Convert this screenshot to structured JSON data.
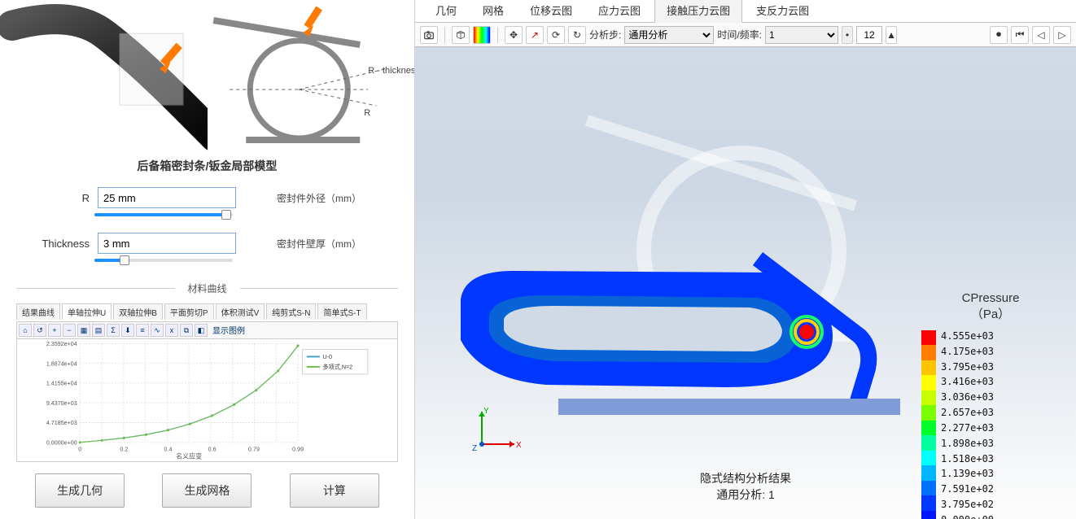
{
  "model_title": "后备箱密封条/钣金局部模型",
  "diagram_labels": {
    "r": "R",
    "thickness": "R - thickness"
  },
  "params": {
    "r": {
      "label": "R",
      "value": "25 mm",
      "desc": "密封件外径（mm）",
      "slider_percent": 95
    },
    "thickness": {
      "label": "Thickness",
      "value": "3 mm",
      "desc": "密封件壁厚（mm）",
      "slider_percent": 22
    }
  },
  "section_material": "材料曲线",
  "mat_tabs": [
    "结果曲线",
    "单轴拉伸U",
    "双轴拉伸B",
    "平面剪切P",
    "体积测试V",
    "纯剪式S-N",
    "简单式S-T"
  ],
  "mat_tab_active": 1,
  "chart_toolbar_legend": "显示图例",
  "chart_legend": {
    "s1": "U-0",
    "s2": "多项式,N=2"
  },
  "chart_xlabel": "名义应变",
  "chart_data": {
    "type": "line",
    "xlabel": "名义应变",
    "ylabel": "",
    "categories": [
      0,
      0.2,
      0.4,
      0.6,
      0.79,
      0.99
    ],
    "y_ticks": [
      "0.0000e+00",
      "4.7185e+03",
      "9.4370e+03",
      "1.4155e+04",
      "1.8874e+04",
      "2.3592e+04"
    ],
    "series": [
      {
        "name": "U-0",
        "x": [
          0,
          0.1,
          0.2,
          0.3,
          0.4,
          0.5,
          0.6,
          0.7,
          0.8,
          0.9,
          0.99
        ],
        "y": [
          0,
          500,
          1100,
          1900,
          3000,
          4500,
          6500,
          9200,
          12700,
          17400,
          23500
        ]
      },
      {
        "name": "多项式,N=2",
        "x": [
          0,
          0.1,
          0.2,
          0.3,
          0.4,
          0.5,
          0.6,
          0.7,
          0.8,
          0.9,
          0.99
        ],
        "y": [
          0,
          480,
          1050,
          1850,
          2950,
          4450,
          6450,
          9150,
          12650,
          17350,
          23450
        ]
      }
    ],
    "xlim": [
      0,
      0.99
    ],
    "ylim": [
      0,
      24000
    ]
  },
  "buttons": {
    "gen_geo": "生成几何",
    "gen_mesh": "生成网格",
    "compute": "计算"
  },
  "tabs": [
    "几何",
    "网格",
    "位移云图",
    "应力云图",
    "接触压力云图",
    "支反力云图"
  ],
  "tab_active": 4,
  "toolbar": {
    "step_label": "分析步:",
    "step_value": "通用分析",
    "time_label": "时间/频率:",
    "time_value": "1",
    "frame_value": "12"
  },
  "result": {
    "line1": "隐式结构分析结果",
    "line2": "通用分析: 1"
  },
  "legend": {
    "title": "CPressure",
    "unit": "（Pa）",
    "colors": [
      "#ff0000",
      "#ff7e00",
      "#ffc400",
      "#ffff00",
      "#c8ff00",
      "#7bff00",
      "#00ff2a",
      "#00ff9e",
      "#00ffff",
      "#00b7ff",
      "#0070ff",
      "#0037ff",
      "#0015ff"
    ],
    "values": [
      "4.555e+03",
      "4.175e+03",
      "3.795e+03",
      "3.416e+03",
      "3.036e+03",
      "2.657e+03",
      "2.277e+03",
      "1.898e+03",
      "1.518e+03",
      "1.139e+03",
      "7.591e+02",
      "3.795e+02",
      "0.000e+00"
    ]
  }
}
